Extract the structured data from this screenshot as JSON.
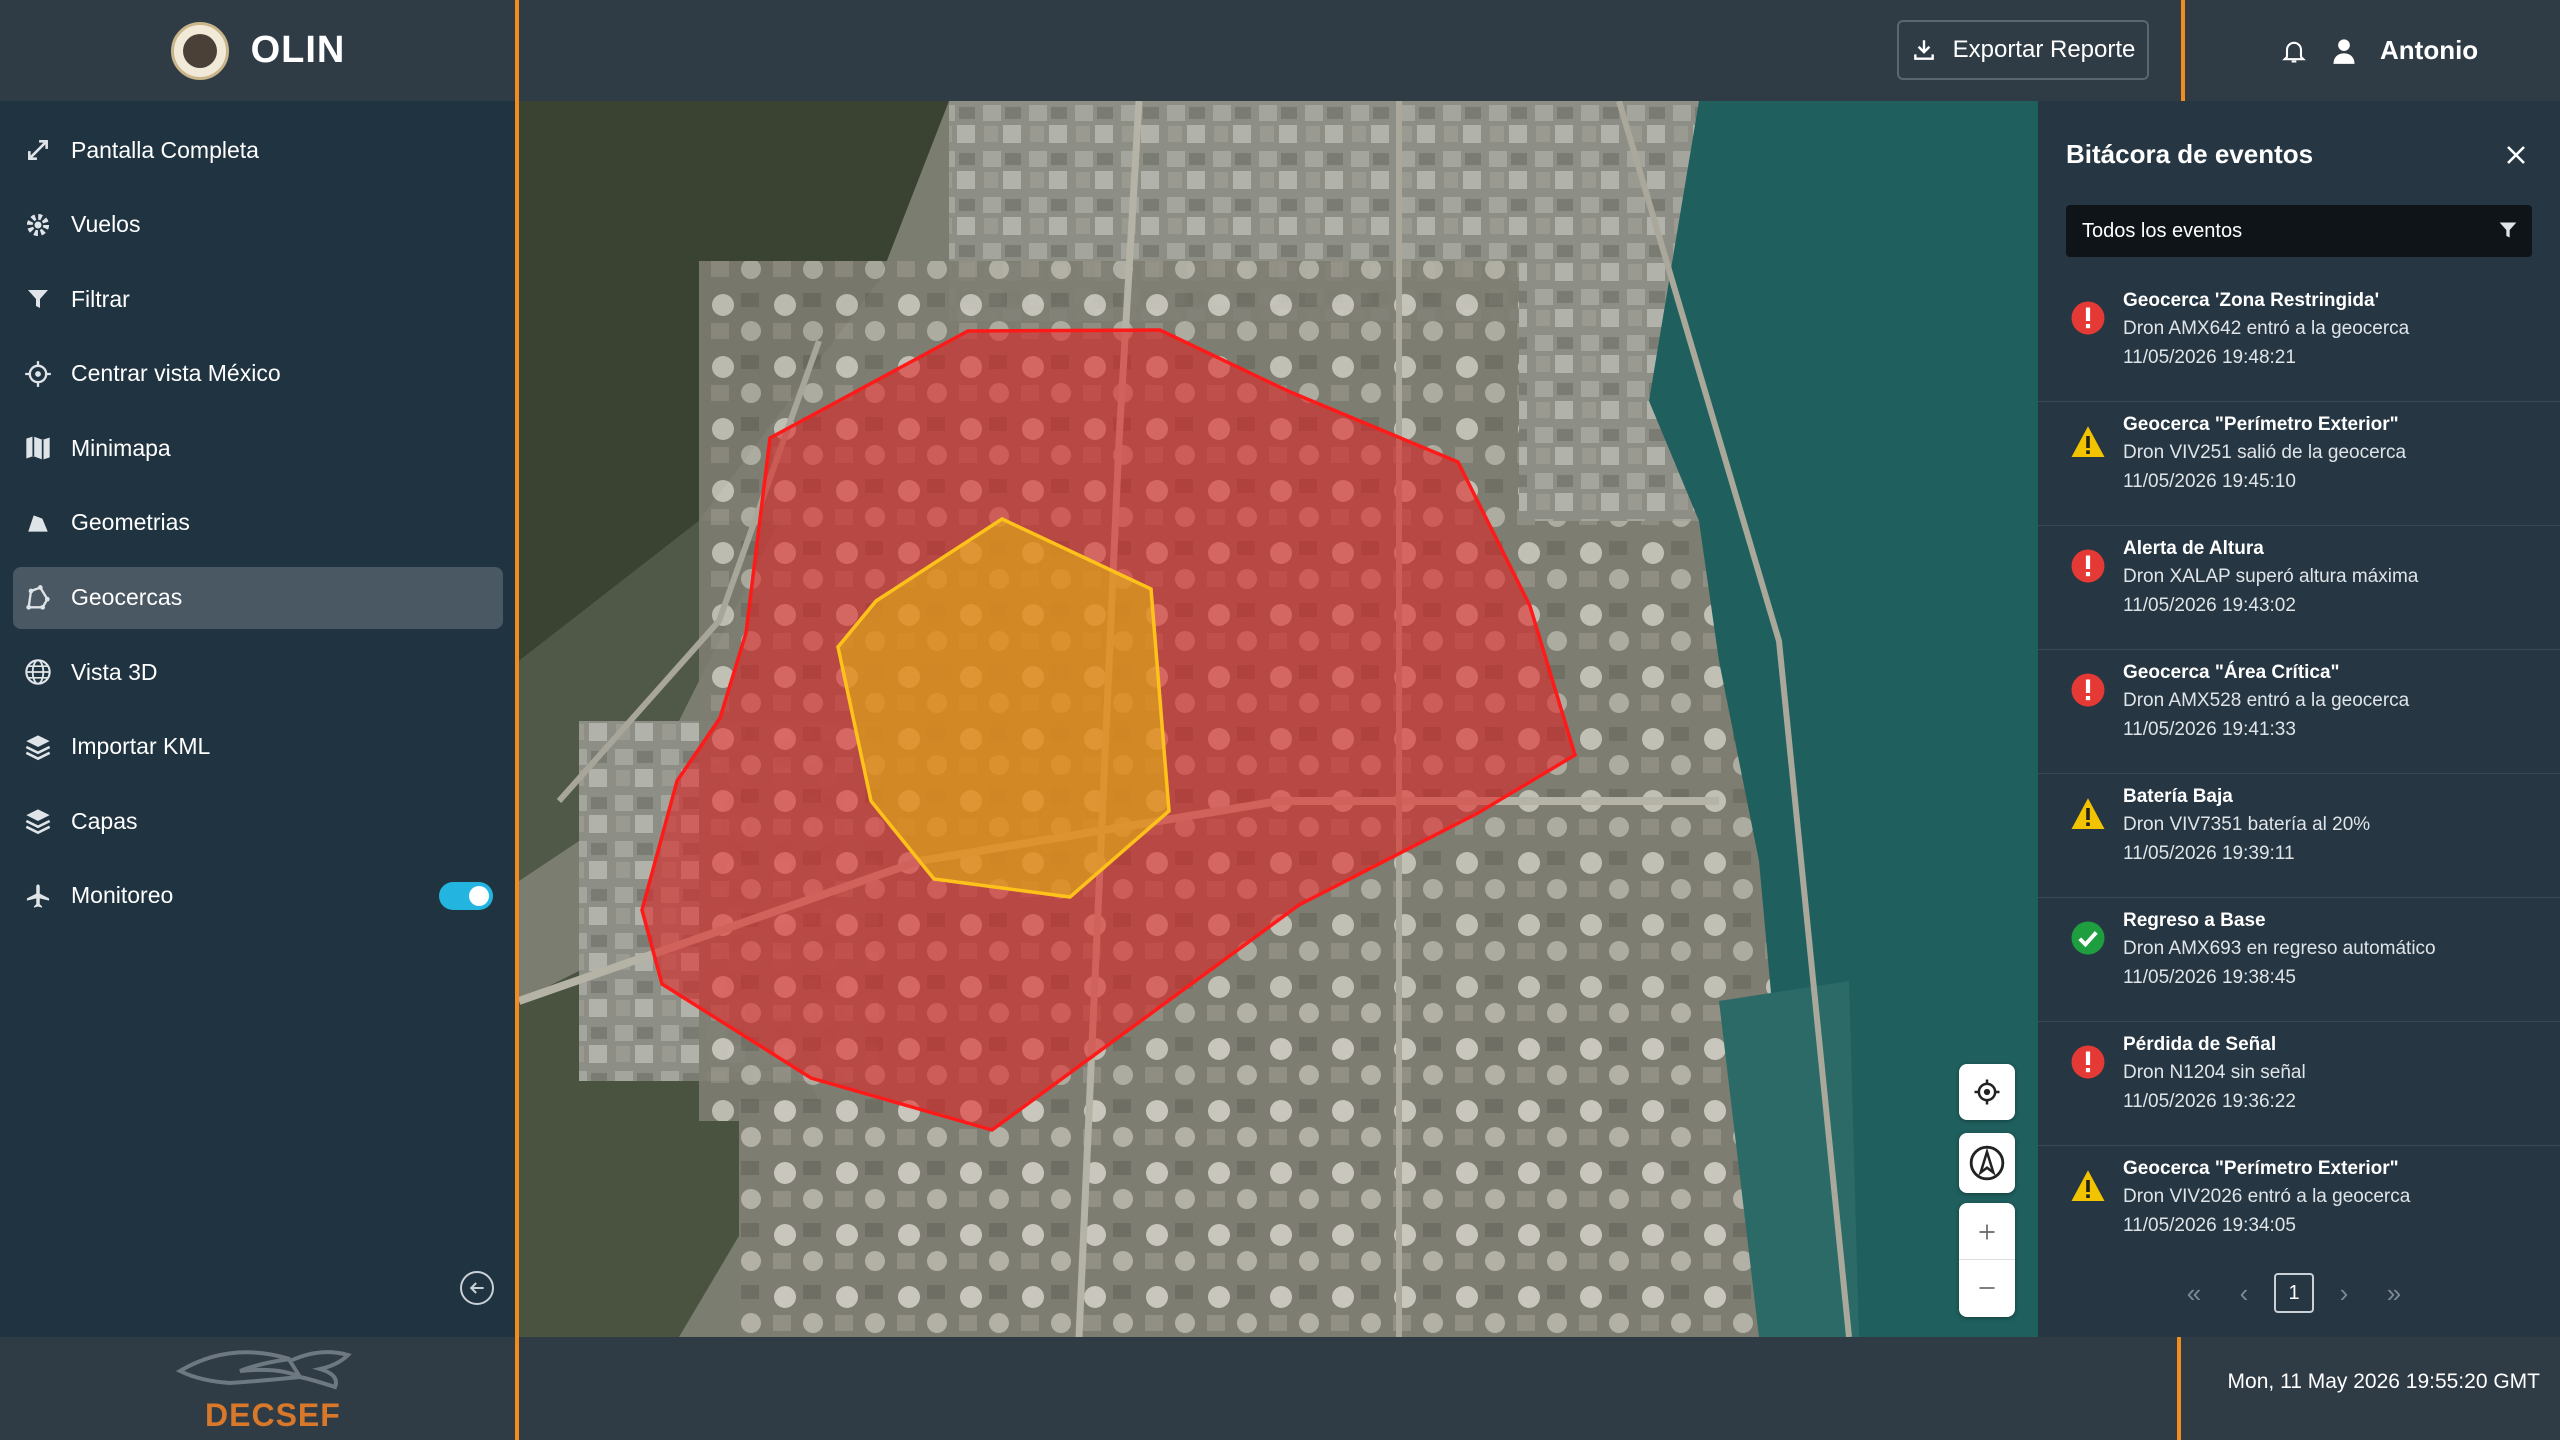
{
  "app": {
    "title": "OLIN"
  },
  "header": {
    "export_label": "Exportar Reporte",
    "user_name": "Antonio"
  },
  "sidebar": {
    "items": [
      {
        "label": "Pantalla Completa",
        "icon": "expand-icon"
      },
      {
        "label": "Vuelos",
        "icon": "gear-icon"
      },
      {
        "label": "Filtrar",
        "icon": "filter-icon"
      },
      {
        "label": "Centrar vista México",
        "icon": "crosshair-icon"
      },
      {
        "label": "Minimapa",
        "icon": "map-icon"
      },
      {
        "label": "Geometrias",
        "icon": "shape-icon"
      },
      {
        "label": "Geocercas",
        "icon": "geofence-icon",
        "active": true
      },
      {
        "label": "Vista 3D",
        "icon": "globe-icon"
      },
      {
        "label": "Importar KML",
        "icon": "layers-icon"
      },
      {
        "label": "Capas",
        "icon": "layers-icon"
      },
      {
        "label": "Monitoreo",
        "icon": "plane-icon",
        "toggle": true
      }
    ]
  },
  "footer": {
    "brand": "DECSEF",
    "datetime": "Mon, 11 May 2026 19:55:20 GMT"
  },
  "events_panel": {
    "title": "Bitácora de eventos",
    "filter_value": "Todos los eventos",
    "events": [
      {
        "type": "error",
        "title": "Geocerca 'Zona Restringida'",
        "description": "Dron AMX642 entró a la geocerca",
        "time": "11/05/2026 19:48:21"
      },
      {
        "type": "warning",
        "title": "Geocerca \"Perímetro Exterior\"",
        "description": "Dron VIV251 salió de la geocerca",
        "time": "11/05/2026 19:45:10"
      },
      {
        "type": "error",
        "title": "Alerta de Altura",
        "description": "Dron XALAP superó altura máxima",
        "time": "11/05/2026 19:43:02"
      },
      {
        "type": "error",
        "title": "Geocerca \"Área Crítica\"",
        "description": "Dron AMX528 entró a la geocerca",
        "time": "11/05/2026 19:41:33"
      },
      {
        "type": "warning",
        "title": "Batería Baja",
        "description": "Dron VIV7351 batería al 20%",
        "time": "11/05/2026 19:39:11"
      },
      {
        "type": "success",
        "title": "Regreso a Base",
        "description": "Dron AMX693 en regreso automático",
        "time": "11/05/2026 19:38:45"
      },
      {
        "type": "error",
        "title": "Pérdida de Señal",
        "description": "Dron N1204 sin señal",
        "time": "11/05/2026 19:36:22"
      },
      {
        "type": "warning",
        "title": "Geocerca \"Perímetro Exterior\"",
        "description": "Dron VIV2026 entró a la geocerca",
        "time": "11/05/2026 19:34:05"
      }
    ],
    "pagination": {
      "current_page": "1"
    }
  },
  "colors": {
    "accent": "#f28c1e",
    "toggle": "#23b5e0",
    "error": "#e53935",
    "warning": "#f2c300",
    "success": "#1e9e3e"
  }
}
